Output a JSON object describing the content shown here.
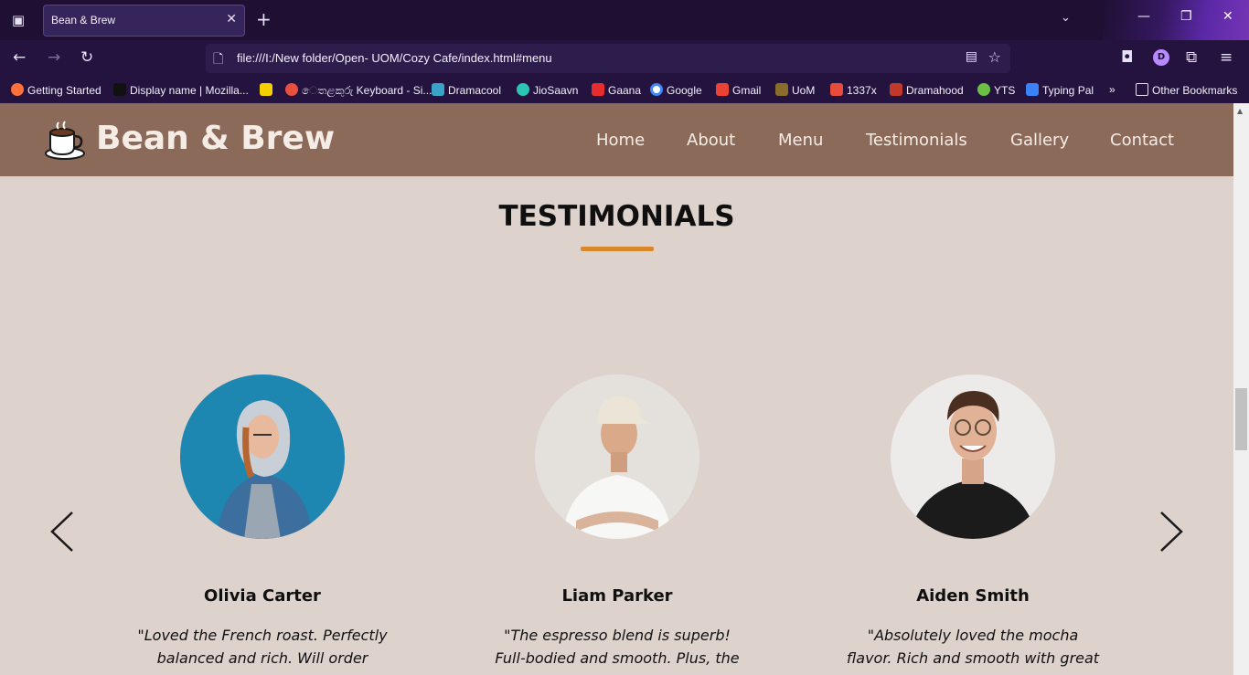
{
  "browser": {
    "tab_title": "Bean & Brew",
    "url": "file:///I:/New folder/Open- UOM/Cozy Cafe/index.html#menu",
    "profile_initial": "D",
    "bookmarks": [
      {
        "label": "Getting Started",
        "icon_color": "#ff7139"
      },
      {
        "label": "Display name | Mozilla...",
        "icon_color": "#111111"
      },
      {
        "label": "",
        "icon_color": "#f5d000"
      },
      {
        "label": "ෙතළකුරු Keyboard - Si...",
        "icon_color": "#e84f3d"
      },
      {
        "label": "Dramacool",
        "icon_color": "#3aa4c8"
      },
      {
        "label": "JioSaavn",
        "icon_color": "#2bc5b4"
      },
      {
        "label": "Gaana",
        "icon_color": "#e72c30"
      },
      {
        "label": "Google",
        "icon_color": "#4285f4"
      },
      {
        "label": "Gmail",
        "icon_color": "#ea4335"
      },
      {
        "label": "UoM",
        "icon_color": "#8a6d2b"
      },
      {
        "label": "1337x",
        "icon_color": "#e84c3d"
      },
      {
        "label": "Dramahood",
        "icon_color": "#c0392b"
      },
      {
        "label": "YTS",
        "icon_color": "#6ac045"
      },
      {
        "label": "Typing Pal",
        "icon_color": "#3b82f6"
      },
      {
        "label": "Other Bookmarks",
        "icon_color": "#e6e1f5"
      }
    ]
  },
  "site": {
    "brand": "Bean & Brew",
    "nav": [
      "Home",
      "About",
      "Menu",
      "Testimonials",
      "Gallery",
      "Contact"
    ],
    "section_title": "TESTIMONIALS",
    "accent_color": "#d8872a",
    "testimonials": [
      {
        "name": "Olivia Carter",
        "quote": "\"Loved the French roast. Perfectly balanced and rich. Will order again!\""
      },
      {
        "name": "Liam Parker",
        "quote": "\"The espresso blend is superb! Full-bodied and smooth. Plus, the"
      },
      {
        "name": "Aiden Smith",
        "quote": "\"Absolutely loved the mocha flavor. Rich and smooth with great"
      }
    ]
  }
}
